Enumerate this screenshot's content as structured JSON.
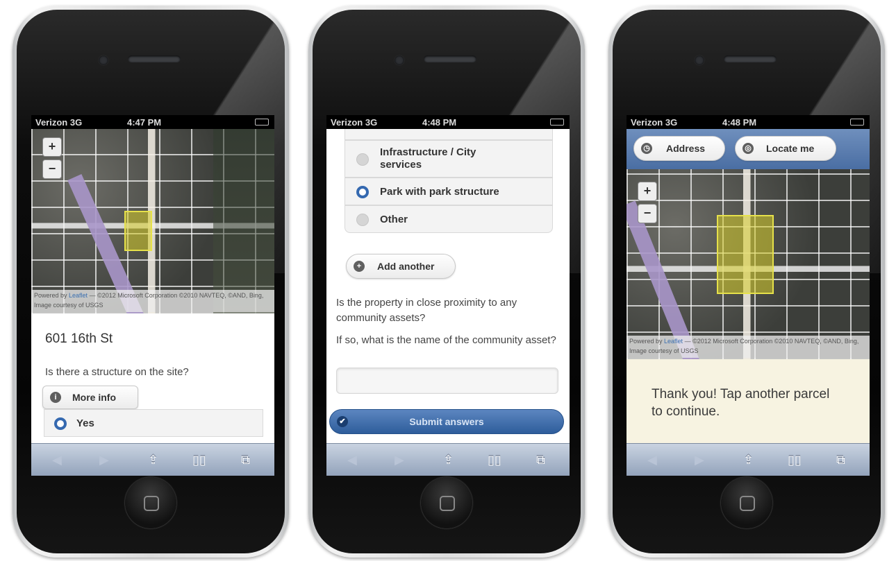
{
  "status": {
    "carrier": "Verizon 3G",
    "phone1_time": "4:47 PM",
    "phone2_time": "4:48 PM",
    "phone3_time": "4:48 PM"
  },
  "map": {
    "attribution_prefix": "Powered by ",
    "attribution_link": "Leaflet",
    "attribution_rest": " — ©2012 Microsoft Corporation ©2010 NAVTEQ, ©AND, Bing, Image courtesy of USGS",
    "zoom_in": "+",
    "zoom_out": "−"
  },
  "phone1": {
    "address": "601 16th St",
    "question": "Is there a structure on the site?",
    "more_info": "More info",
    "answer_yes": "Yes"
  },
  "phone2": {
    "options": [
      "Infrastructure / City services",
      "Park with park structure",
      "Other"
    ],
    "selected_option": "Park with park structure",
    "add_another": "Add another",
    "question1": "Is the property in close proximity to any community assets?",
    "question2": "If so, what is the name of the community asset?",
    "asset_value": "",
    "submit": "Submit answers"
  },
  "phone3": {
    "address_button": "Address",
    "locate_button": "Locate me",
    "thanks": "Thank you! Tap another parcel to continue."
  },
  "toolbar": {
    "back": "◀",
    "forward": "▶",
    "share": "⇪",
    "bookmarks": "▯▯",
    "tabs": "⧉"
  },
  "icons": {
    "info": "info-icon",
    "add": "plus-circle-icon",
    "check": "check-circle-icon",
    "address": "clock-icon",
    "locate": "target-icon"
  },
  "colors": {
    "accent": "#3569b0",
    "parcel": "#e6e14a",
    "highway": "#a996c9",
    "thanks_bg": "#f7f3e1"
  }
}
